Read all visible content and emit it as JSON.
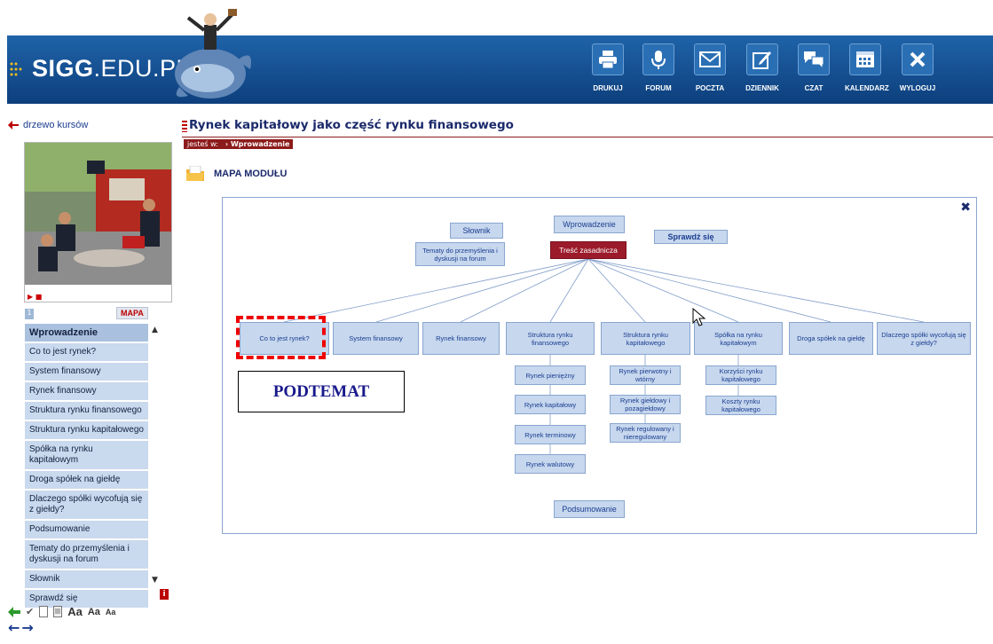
{
  "header": {
    "logo_main": "SIGG",
    "logo_rest": ".EDU.PL",
    "toolbar": [
      {
        "label": "DRUKUJ",
        "icon": "printer-icon"
      },
      {
        "label": "FORUM",
        "icon": "microphone-icon"
      },
      {
        "label": "POCZTA",
        "icon": "envelope-icon"
      },
      {
        "label": "DZIENNIK",
        "icon": "edit-icon"
      },
      {
        "label": "CZAT",
        "icon": "chat-icon"
      },
      {
        "label": "KALENDARZ",
        "icon": "calendar-icon"
      },
      {
        "label": "WYLOGUJ",
        "icon": "close-icon"
      }
    ]
  },
  "sidebar": {
    "back_link": "drzewo kursów",
    "page_num": "1",
    "mapa_badge": "MAPA",
    "items": [
      "Wprowadzenie",
      "Co to jest rynek?",
      "System finansowy",
      "Rynek finansowy",
      "Struktura rynku finansowego",
      "Struktura rynku kapitałowego",
      "Spółka na rynku kapitałowym",
      "Droga spółek na giełdę",
      "Dlaczego spółki wycofują się z giełdy?",
      "Podsumowanie",
      "Tematy do przemyślenia i dyskusji na forum",
      "Słownik",
      "Sprawdź się"
    ],
    "font_sizes": [
      "Aa",
      "Aa",
      "Aa"
    ],
    "info_label": "i"
  },
  "main": {
    "title": "Rynek kapitałowy jako część rynku finansowego",
    "crumb_label": "jesteś w:",
    "crumb_current": "Wprowadzenie",
    "mapa_title": "MAPA MODUŁU"
  },
  "map": {
    "top": {
      "slownik": "Słownik",
      "tematy": "Tematy do przemyślenia i dyskusji na forum",
      "wprowadzenie": "Wprowadzenie",
      "tresc": "Treść zasadnicza",
      "sprawdz": "Sprawdź się",
      "podsumowanie": "Podsumowanie"
    },
    "topics": [
      "Co to jest rynek?",
      "System finansowy",
      "Rynek finansowy",
      "Struktura rynku finansowego",
      "Struktura rynku kapitałowego",
      "Spółka na rynku kapitałowym",
      "Droga spółek na giełdę",
      "Dlaczego spółki wycofują się z giełdy?"
    ],
    "sub_finansowy": [
      "Rynek pieniężny",
      "Rynek kapitałowy",
      "Rynek terminowy",
      "Rynek walutowy"
    ],
    "sub_kapitalowy": [
      "Rynek pierwotny i wtórny",
      "Rynek giełdowy i pozagiełdowy",
      "Rynek regulowany i nieregulowany"
    ],
    "sub_spolka": [
      "Korzyści rynku kapitałowego",
      "Koszty rynku kapitałowego"
    ]
  },
  "annotation": {
    "podtemat": "PODTEMAT"
  }
}
